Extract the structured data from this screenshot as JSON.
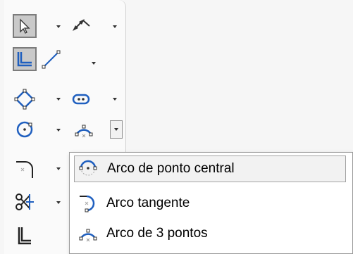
{
  "toolbar": {
    "tools": [
      {
        "name": "select-pointer",
        "icon": "cursor-arrow-icon",
        "selected": true
      },
      {
        "name": "smart-dimension",
        "icon": "smart-dimension-icon",
        "selected": false
      },
      {
        "name": "corner-rectangle",
        "icon": "corner-rectangle-icon",
        "selected": true
      },
      {
        "name": "line",
        "icon": "line-icon",
        "selected": false
      },
      {
        "name": "polygon",
        "icon": "polygon-icon",
        "selected": false
      },
      {
        "name": "slot",
        "icon": "slot-icon",
        "selected": false
      },
      {
        "name": "circle",
        "icon": "circle-icon",
        "selected": false
      },
      {
        "name": "arc",
        "icon": "three-point-arc-icon",
        "selected": false
      },
      {
        "name": "fillet",
        "icon": "sketch-fillet-icon",
        "selected": false
      },
      {
        "name": "trim",
        "icon": "trim-entities-icon",
        "selected": false
      },
      {
        "name": "offset",
        "icon": "offset-entities-icon",
        "selected": false
      }
    ]
  },
  "arc_menu": {
    "items": [
      {
        "label": "Arco de ponto central",
        "icon": "centerpoint-arc-icon",
        "highlighted": true
      },
      {
        "label": "Arco tangente",
        "icon": "tangent-arc-icon",
        "highlighted": false
      },
      {
        "label": "Arco de 3 pontos",
        "icon": "three-point-arc-icon",
        "highlighted": false
      }
    ]
  },
  "colors": {
    "accent_blue": "#1f5fbf",
    "selected_bg": "#c9c9c9",
    "menu_bg": "#ffffff"
  }
}
